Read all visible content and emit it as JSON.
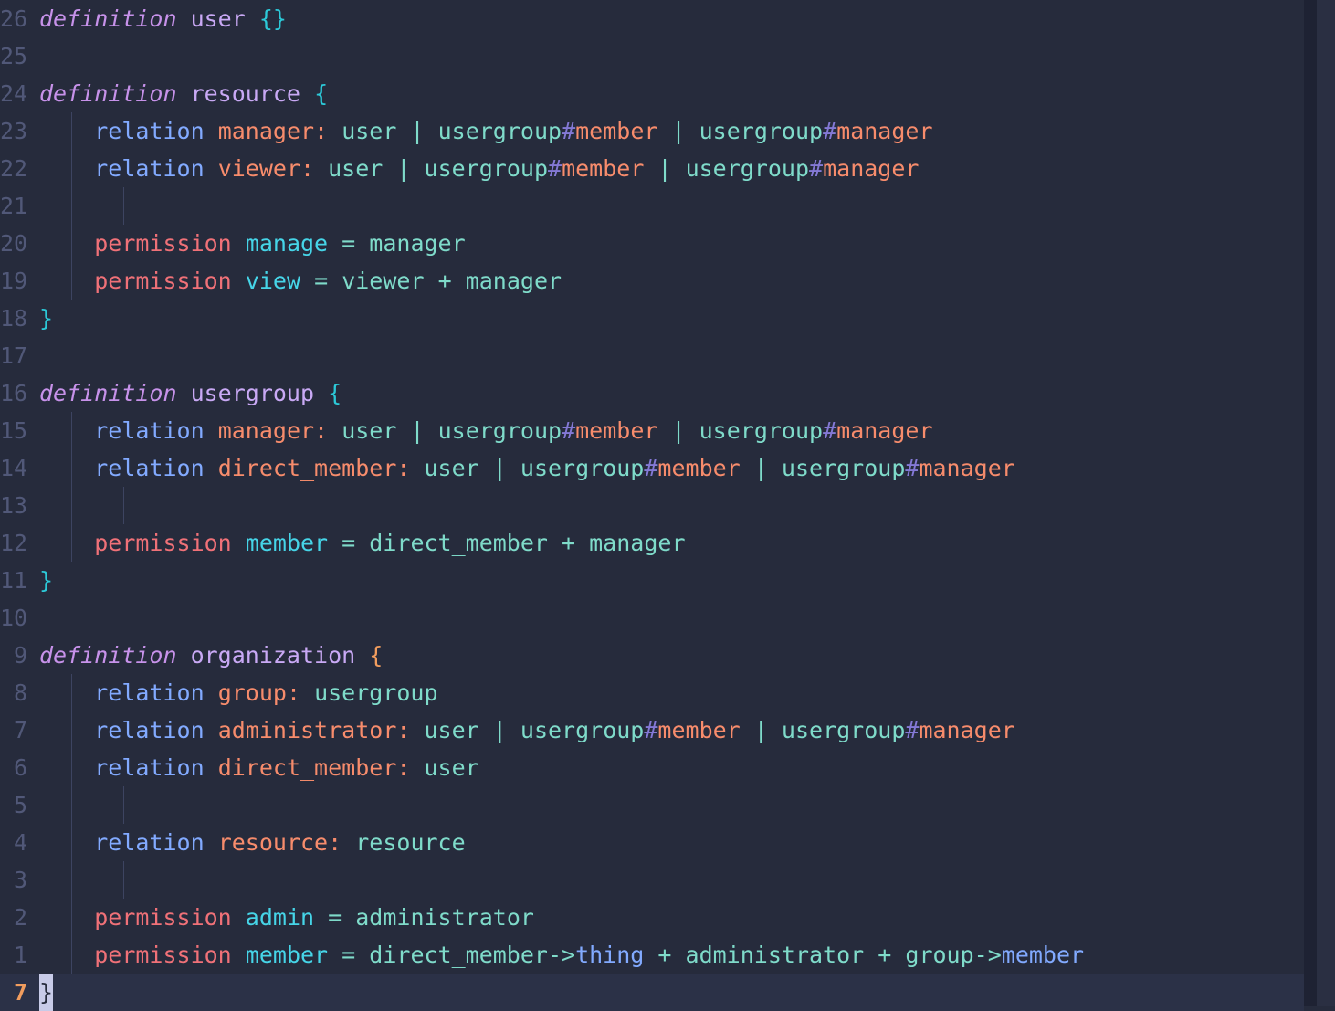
{
  "editor": {
    "name": "schema-editor",
    "background": "#262b3c",
    "cursor_line_background": "#2b3147",
    "gutter_color": "#515878",
    "current_line_number_color": "#f29d5e",
    "cursor_block_color": "#c8cbe8"
  },
  "palette": {
    "keyword_definition": "#c792ea",
    "definition_name": "#c9a9f5",
    "bracket_cyan": "#2cc9d8",
    "bracket_orange": "#f29d5e",
    "keyword_relation": "#82aaff",
    "relation_name": "#f78c6c",
    "type_name": "#7fdbca",
    "hash_sign": "#8479d6",
    "keyword_permission": "#f07178",
    "permission_name": "#46d5e8",
    "subject_relation": "#82aaff"
  },
  "cursor": {
    "absolute_line_number": "7",
    "character": "}"
  },
  "lines": [
    {
      "num": "26",
      "indent": 0,
      "guides": [],
      "text": "definition user {}"
    },
    {
      "num": "25",
      "indent": 0,
      "guides": [],
      "text": ""
    },
    {
      "num": "24",
      "indent": 0,
      "guides": [],
      "text": "definition resource {"
    },
    {
      "num": "23",
      "indent": 1,
      "guides": [
        "a"
      ],
      "text": "    relation manager: user | usergroup#member | usergroup#manager"
    },
    {
      "num": "22",
      "indent": 1,
      "guides": [
        "a"
      ],
      "text": "    relation viewer: user | usergroup#member | usergroup#manager"
    },
    {
      "num": "21",
      "indent": 1,
      "guides": [
        "a",
        "b"
      ],
      "text": ""
    },
    {
      "num": "20",
      "indent": 1,
      "guides": [
        "a"
      ],
      "text": "    permission manage = manager"
    },
    {
      "num": "19",
      "indent": 1,
      "guides": [
        "a"
      ],
      "text": "    permission view = viewer + manager"
    },
    {
      "num": "18",
      "indent": 0,
      "guides": [],
      "text": "}"
    },
    {
      "num": "17",
      "indent": 0,
      "guides": [],
      "text": ""
    },
    {
      "num": "16",
      "indent": 0,
      "guides": [],
      "text": "definition usergroup {"
    },
    {
      "num": "15",
      "indent": 1,
      "guides": [
        "a"
      ],
      "text": "    relation manager: user | usergroup#member | usergroup#manager"
    },
    {
      "num": "14",
      "indent": 1,
      "guides": [
        "a"
      ],
      "text": "    relation direct_member: user | usergroup#member | usergroup#manager"
    },
    {
      "num": "13",
      "indent": 1,
      "guides": [
        "a",
        "b"
      ],
      "text": ""
    },
    {
      "num": "12",
      "indent": 1,
      "guides": [
        "a"
      ],
      "text": "    permission member = direct_member + manager"
    },
    {
      "num": "11",
      "indent": 0,
      "guides": [],
      "text": "}"
    },
    {
      "num": "10",
      "indent": 0,
      "guides": [],
      "text": ""
    },
    {
      "num": "9",
      "indent": 0,
      "guides": [],
      "text": "definition organization {"
    },
    {
      "num": "8",
      "indent": 1,
      "guides": [
        "a"
      ],
      "text": "    relation group: usergroup"
    },
    {
      "num": "7",
      "indent": 1,
      "guides": [
        "a"
      ],
      "text": "    relation administrator: user | usergroup#member | usergroup#manager"
    },
    {
      "num": "6",
      "indent": 1,
      "guides": [
        "a"
      ],
      "text": "    relation direct_member: user"
    },
    {
      "num": "5",
      "indent": 1,
      "guides": [
        "a",
        "b"
      ],
      "text": ""
    },
    {
      "num": "4",
      "indent": 1,
      "guides": [
        "a"
      ],
      "text": "    relation resource: resource"
    },
    {
      "num": "3",
      "indent": 1,
      "guides": [
        "a",
        "b"
      ],
      "text": ""
    },
    {
      "num": "2",
      "indent": 1,
      "guides": [
        "a"
      ],
      "text": "    permission admin = administrator"
    },
    {
      "num": "1",
      "indent": 1,
      "guides": [
        "a"
      ],
      "text": "    permission member = direct_member->thing + administrator + group->member"
    },
    {
      "num": "7",
      "indent": 0,
      "guides": [],
      "text": "}",
      "current": true
    }
  ],
  "tokens": {
    "line_26": [
      {
        "t": "definition",
        "c": "kw-def"
      },
      {
        "t": " ",
        "c": "plain"
      },
      {
        "t": "user",
        "c": "def-name"
      },
      {
        "t": " ",
        "c": "plain"
      },
      {
        "t": "{}",
        "c": "brace-c"
      }
    ],
    "line_24": [
      {
        "t": "definition",
        "c": "kw-def"
      },
      {
        "t": " ",
        "c": "plain"
      },
      {
        "t": "resource",
        "c": "def-name"
      },
      {
        "t": " ",
        "c": "plain"
      },
      {
        "t": "{",
        "c": "brace-c"
      }
    ],
    "line_23": [
      {
        "t": "    ",
        "c": "plain"
      },
      {
        "t": "relation",
        "c": "kw-relation"
      },
      {
        "t": " ",
        "c": "plain"
      },
      {
        "t": "manager:",
        "c": "rel-name"
      },
      {
        "t": " ",
        "c": "plain"
      },
      {
        "t": "user",
        "c": "type"
      },
      {
        "t": " ",
        "c": "plain"
      },
      {
        "t": "|",
        "c": "punct-teal"
      },
      {
        "t": " ",
        "c": "plain"
      },
      {
        "t": "usergroup",
        "c": "type"
      },
      {
        "t": "#",
        "c": "hash"
      },
      {
        "t": "member",
        "c": "hash-rel"
      },
      {
        "t": " ",
        "c": "plain"
      },
      {
        "t": "|",
        "c": "punct-teal"
      },
      {
        "t": " ",
        "c": "plain"
      },
      {
        "t": "usergroup",
        "c": "type"
      },
      {
        "t": "#",
        "c": "hash"
      },
      {
        "t": "manager",
        "c": "hash-rel"
      }
    ],
    "line_22": [
      {
        "t": "    ",
        "c": "plain"
      },
      {
        "t": "relation",
        "c": "kw-relation"
      },
      {
        "t": " ",
        "c": "plain"
      },
      {
        "t": "viewer:",
        "c": "rel-name"
      },
      {
        "t": " ",
        "c": "plain"
      },
      {
        "t": "user",
        "c": "type"
      },
      {
        "t": " ",
        "c": "plain"
      },
      {
        "t": "|",
        "c": "punct-teal"
      },
      {
        "t": " ",
        "c": "plain"
      },
      {
        "t": "usergroup",
        "c": "type"
      },
      {
        "t": "#",
        "c": "hash"
      },
      {
        "t": "member",
        "c": "hash-rel"
      },
      {
        "t": " ",
        "c": "plain"
      },
      {
        "t": "|",
        "c": "punct-teal"
      },
      {
        "t": " ",
        "c": "plain"
      },
      {
        "t": "usergroup",
        "c": "type"
      },
      {
        "t": "#",
        "c": "hash"
      },
      {
        "t": "manager",
        "c": "hash-rel"
      }
    ],
    "line_20": [
      {
        "t": "    ",
        "c": "plain"
      },
      {
        "t": "permission",
        "c": "kw-perm"
      },
      {
        "t": " ",
        "c": "plain"
      },
      {
        "t": "manage",
        "c": "perm-name"
      },
      {
        "t": " ",
        "c": "plain"
      },
      {
        "t": "=",
        "c": "punct-teal"
      },
      {
        "t": " ",
        "c": "plain"
      },
      {
        "t": "manager",
        "c": "type"
      }
    ],
    "line_19": [
      {
        "t": "    ",
        "c": "plain"
      },
      {
        "t": "permission",
        "c": "kw-perm"
      },
      {
        "t": " ",
        "c": "plain"
      },
      {
        "t": "view",
        "c": "perm-name"
      },
      {
        "t": " ",
        "c": "plain"
      },
      {
        "t": "=",
        "c": "punct-teal"
      },
      {
        "t": " ",
        "c": "plain"
      },
      {
        "t": "viewer",
        "c": "type"
      },
      {
        "t": " ",
        "c": "plain"
      },
      {
        "t": "+",
        "c": "punct-teal"
      },
      {
        "t": " ",
        "c": "plain"
      },
      {
        "t": "manager",
        "c": "type"
      }
    ],
    "line_18": [
      {
        "t": "}",
        "c": "brace-c"
      }
    ],
    "line_16": [
      {
        "t": "definition",
        "c": "kw-def"
      },
      {
        "t": " ",
        "c": "plain"
      },
      {
        "t": "usergroup",
        "c": "def-name"
      },
      {
        "t": " ",
        "c": "plain"
      },
      {
        "t": "{",
        "c": "brace-c"
      }
    ],
    "line_15": [
      {
        "t": "    ",
        "c": "plain"
      },
      {
        "t": "relation",
        "c": "kw-relation"
      },
      {
        "t": " ",
        "c": "plain"
      },
      {
        "t": "manager:",
        "c": "rel-name"
      },
      {
        "t": " ",
        "c": "plain"
      },
      {
        "t": "user",
        "c": "type"
      },
      {
        "t": " ",
        "c": "plain"
      },
      {
        "t": "|",
        "c": "punct-teal"
      },
      {
        "t": " ",
        "c": "plain"
      },
      {
        "t": "usergroup",
        "c": "type"
      },
      {
        "t": "#",
        "c": "hash"
      },
      {
        "t": "member",
        "c": "hash-rel"
      },
      {
        "t": " ",
        "c": "plain"
      },
      {
        "t": "|",
        "c": "punct-teal"
      },
      {
        "t": " ",
        "c": "plain"
      },
      {
        "t": "usergroup",
        "c": "type"
      },
      {
        "t": "#",
        "c": "hash"
      },
      {
        "t": "manager",
        "c": "hash-rel"
      }
    ],
    "line_14": [
      {
        "t": "    ",
        "c": "plain"
      },
      {
        "t": "relation",
        "c": "kw-relation"
      },
      {
        "t": " ",
        "c": "plain"
      },
      {
        "t": "direct_member:",
        "c": "rel-name"
      },
      {
        "t": " ",
        "c": "plain"
      },
      {
        "t": "user",
        "c": "type"
      },
      {
        "t": " ",
        "c": "plain"
      },
      {
        "t": "|",
        "c": "punct-teal"
      },
      {
        "t": " ",
        "c": "plain"
      },
      {
        "t": "usergroup",
        "c": "type"
      },
      {
        "t": "#",
        "c": "hash"
      },
      {
        "t": "member",
        "c": "hash-rel"
      },
      {
        "t": " ",
        "c": "plain"
      },
      {
        "t": "|",
        "c": "punct-teal"
      },
      {
        "t": " ",
        "c": "plain"
      },
      {
        "t": "usergroup",
        "c": "type"
      },
      {
        "t": "#",
        "c": "hash"
      },
      {
        "t": "manager",
        "c": "hash-rel"
      }
    ],
    "line_12": [
      {
        "t": "    ",
        "c": "plain"
      },
      {
        "t": "permission",
        "c": "kw-perm"
      },
      {
        "t": " ",
        "c": "plain"
      },
      {
        "t": "member",
        "c": "perm-name"
      },
      {
        "t": " ",
        "c": "plain"
      },
      {
        "t": "=",
        "c": "punct-teal"
      },
      {
        "t": " ",
        "c": "plain"
      },
      {
        "t": "direct_member",
        "c": "type"
      },
      {
        "t": " ",
        "c": "plain"
      },
      {
        "t": "+",
        "c": "punct-teal"
      },
      {
        "t": " ",
        "c": "plain"
      },
      {
        "t": "manager",
        "c": "type"
      }
    ],
    "line_11": [
      {
        "t": "}",
        "c": "brace-c"
      }
    ],
    "line_9": [
      {
        "t": "definition",
        "c": "kw-def"
      },
      {
        "t": " ",
        "c": "plain"
      },
      {
        "t": "organization",
        "c": "def-name"
      },
      {
        "t": " ",
        "c": "plain"
      },
      {
        "t": "{",
        "c": "brace-o"
      }
    ],
    "line_8": [
      {
        "t": "    ",
        "c": "plain"
      },
      {
        "t": "relation",
        "c": "kw-relation"
      },
      {
        "t": " ",
        "c": "plain"
      },
      {
        "t": "group:",
        "c": "rel-name"
      },
      {
        "t": " ",
        "c": "plain"
      },
      {
        "t": "usergroup",
        "c": "type"
      }
    ],
    "line_7": [
      {
        "t": "    ",
        "c": "plain"
      },
      {
        "t": "relation",
        "c": "kw-relation"
      },
      {
        "t": " ",
        "c": "plain"
      },
      {
        "t": "administrator:",
        "c": "rel-name"
      },
      {
        "t": " ",
        "c": "plain"
      },
      {
        "t": "user",
        "c": "type"
      },
      {
        "t": " ",
        "c": "plain"
      },
      {
        "t": "|",
        "c": "punct-teal"
      },
      {
        "t": " ",
        "c": "plain"
      },
      {
        "t": "usergroup",
        "c": "type"
      },
      {
        "t": "#",
        "c": "hash"
      },
      {
        "t": "member",
        "c": "hash-rel"
      },
      {
        "t": " ",
        "c": "plain"
      },
      {
        "t": "|",
        "c": "punct-teal"
      },
      {
        "t": " ",
        "c": "plain"
      },
      {
        "t": "usergroup",
        "c": "type"
      },
      {
        "t": "#",
        "c": "hash"
      },
      {
        "t": "manager",
        "c": "hash-rel"
      }
    ],
    "line_6": [
      {
        "t": "    ",
        "c": "plain"
      },
      {
        "t": "relation",
        "c": "kw-relation"
      },
      {
        "t": " ",
        "c": "plain"
      },
      {
        "t": "direct_member:",
        "c": "rel-name"
      },
      {
        "t": " ",
        "c": "plain"
      },
      {
        "t": "user",
        "c": "type"
      }
    ],
    "line_4": [
      {
        "t": "    ",
        "c": "plain"
      },
      {
        "t": "relation",
        "c": "kw-relation"
      },
      {
        "t": " ",
        "c": "plain"
      },
      {
        "t": "resource:",
        "c": "rel-name"
      },
      {
        "t": " ",
        "c": "plain"
      },
      {
        "t": "resource",
        "c": "type"
      }
    ],
    "line_2": [
      {
        "t": "    ",
        "c": "plain"
      },
      {
        "t": "permission",
        "c": "kw-perm"
      },
      {
        "t": " ",
        "c": "plain"
      },
      {
        "t": "admin",
        "c": "perm-name"
      },
      {
        "t": " ",
        "c": "plain"
      },
      {
        "t": "=",
        "c": "punct-teal"
      },
      {
        "t": " ",
        "c": "plain"
      },
      {
        "t": "administrator",
        "c": "type"
      }
    ],
    "line_1": [
      {
        "t": "    ",
        "c": "plain"
      },
      {
        "t": "permission",
        "c": "kw-perm"
      },
      {
        "t": " ",
        "c": "plain"
      },
      {
        "t": "member",
        "c": "perm-name"
      },
      {
        "t": " ",
        "c": "plain"
      },
      {
        "t": "=",
        "c": "punct-teal"
      },
      {
        "t": " ",
        "c": "plain"
      },
      {
        "t": "direct_member",
        "c": "type"
      },
      {
        "t": "->",
        "c": "arrow"
      },
      {
        "t": "thing",
        "c": "subject"
      },
      {
        "t": " ",
        "c": "plain"
      },
      {
        "t": "+",
        "c": "punct-teal"
      },
      {
        "t": " ",
        "c": "plain"
      },
      {
        "t": "administrator",
        "c": "type"
      },
      {
        "t": " ",
        "c": "plain"
      },
      {
        "t": "+",
        "c": "punct-teal"
      },
      {
        "t": " ",
        "c": "plain"
      },
      {
        "t": "group",
        "c": "type"
      },
      {
        "t": "->",
        "c": "arrow"
      },
      {
        "t": "member",
        "c": "subject"
      }
    ],
    "line_cursor": [
      {
        "t": "}",
        "c": "cursor-block"
      }
    ]
  },
  "line_order": [
    "line_26",
    "blank_25",
    "line_24",
    "line_23",
    "line_22",
    "blank_21",
    "line_20",
    "line_19",
    "line_18",
    "blank_17",
    "line_16",
    "line_15",
    "line_14",
    "blank_13",
    "line_12",
    "line_11",
    "blank_10",
    "line_9",
    "line_8",
    "line_7",
    "line_6",
    "blank_5",
    "line_4",
    "blank_3",
    "line_2",
    "line_1",
    "line_cursor"
  ]
}
